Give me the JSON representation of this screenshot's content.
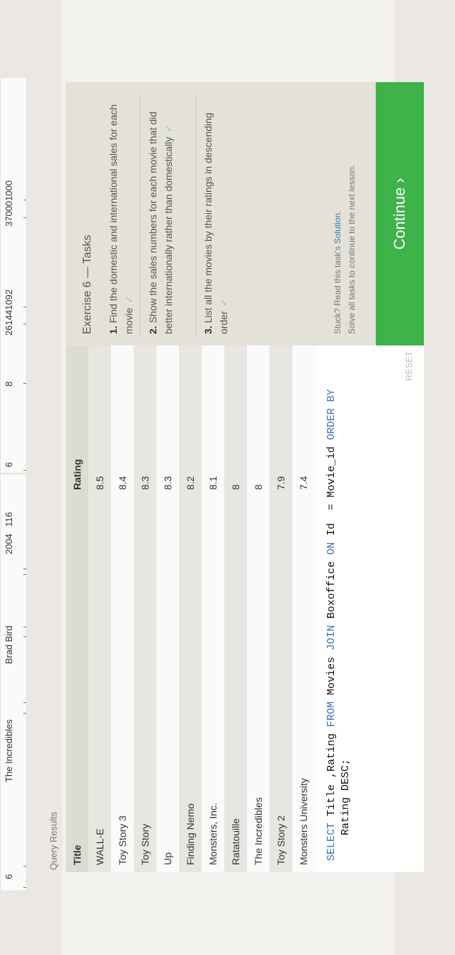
{
  "background_tables": {
    "left": {
      "row": [
        "6",
        "The Incredibles",
        "Brad Bird",
        "2004",
        "116"
      ]
    },
    "right": {
      "row": [
        "6",
        "8",
        "261441092",
        "370001000"
      ]
    }
  },
  "query_results": {
    "label": "Query Results",
    "columns": [
      "Title",
      "Rating"
    ],
    "rows": [
      [
        "WALL-E",
        "8.5"
      ],
      [
        "Toy Story 3",
        "8.4"
      ],
      [
        "Toy Story",
        "8.3"
      ],
      [
        "Up",
        "8.3"
      ],
      [
        "Finding Nemo",
        "8.2"
      ],
      [
        "Monsters, Inc.",
        "8.1"
      ],
      [
        "Ratatouille",
        "8"
      ],
      [
        "The Incredibles",
        "8"
      ],
      [
        "Toy Story 2",
        "7.9"
      ],
      [
        "Monsters University",
        "7.4"
      ]
    ],
    "scroll_left_icon": "chevron-left-icon",
    "scroll_right_icon": "chevron-right-icon"
  },
  "editor": {
    "line1": "SELECT Title ,Rating FROM Movies JOIN Boxoffice ON Id  = Movie_id ORDER BY",
    "line2": "    Rating DESC;",
    "reset_label": "RESET"
  },
  "tasks": {
    "title": "Exercise 6 — Tasks",
    "items": [
      {
        "num": "1.",
        "text": "Find the domestic and international sales for each movie"
      },
      {
        "num": "2.",
        "text": "Show the sales numbers for each movie that did better internationally rather than domestically"
      },
      {
        "num": "3.",
        "text": "List all the movies by their ratings in descending order"
      }
    ],
    "check_icon": "checkmark-icon",
    "stuck_prefix": "Stuck? Read this task's ",
    "stuck_link": "Solution",
    "stuck_suffix": ".",
    "solve_all": "Solve all tasks to continue to the next lesson."
  },
  "continue_label": "Continue ›",
  "colors": {
    "accent_green": "#3db34a",
    "keyword_blue": "#3b73b9",
    "check_green": "#8fd27e"
  }
}
